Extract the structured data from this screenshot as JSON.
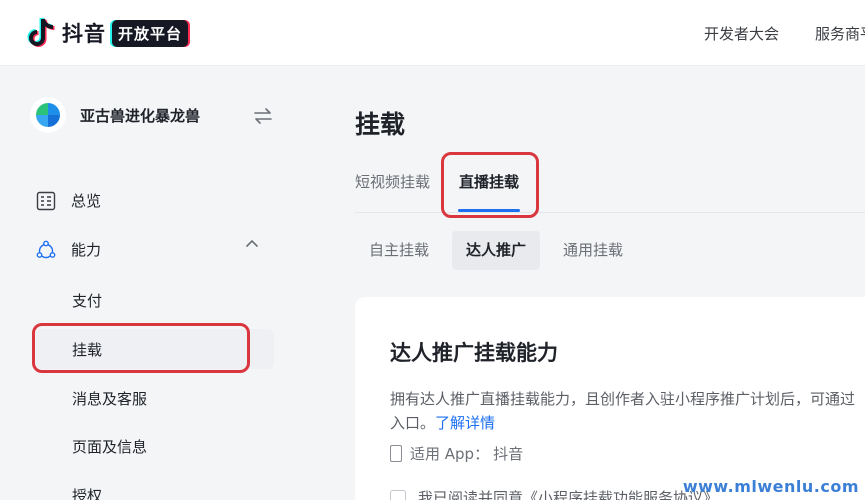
{
  "header": {
    "logo_text": "抖音",
    "logo_badge": "开放平台",
    "nav": [
      "开发者大会",
      "服务商平"
    ]
  },
  "sidebar": {
    "account_name": "亚古兽进化暴龙兽",
    "menu": {
      "overview": "总览",
      "capability": "能力",
      "sub_items": [
        "支付",
        "挂载",
        "消息及客服",
        "页面及信息",
        "授权"
      ]
    }
  },
  "main": {
    "title": "挂载",
    "tabs": [
      "短视频挂载",
      "直播挂载"
    ],
    "active_tab": "直播挂载",
    "segments": [
      "自主挂载",
      "达人推广",
      "通用挂载"
    ],
    "active_segment": "达人推广",
    "card": {
      "title": "达人推广挂载能力",
      "desc_line1": "拥有达人推广直播挂载能力，且创作者入驻小程序推广计划后，可通过",
      "desc_line2": "入口。",
      "link": "了解详情",
      "app_prefix": "适用 App：",
      "app_name": "抖音",
      "agreement": "我已阅读并同意《小程序挂载功能服务协议》"
    }
  },
  "watermark": "www.mlwenlu.com",
  "colors": {
    "accent": "#1d6ff2",
    "highlight": "#d9363e"
  }
}
